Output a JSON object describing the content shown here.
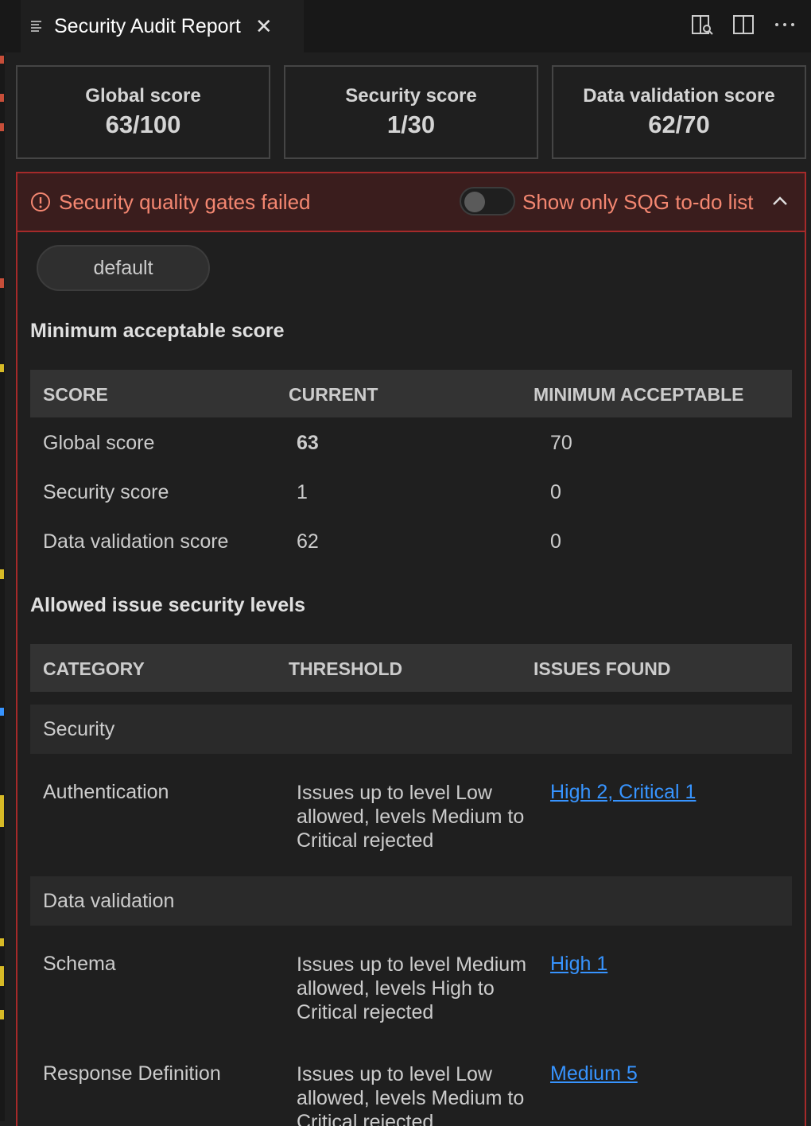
{
  "tab": {
    "title": "Security Audit Report"
  },
  "scores": [
    {
      "label": "Global score",
      "value": "63/100"
    },
    {
      "label": "Security score",
      "value": "1/30"
    },
    {
      "label": "Data validation score",
      "value": "62/70"
    }
  ],
  "gate": {
    "status_text": "Security quality gates failed",
    "toggle_label": "Show only SQG to-do list",
    "toggle_on": false
  },
  "profile_chip": "default",
  "min_score": {
    "title": "Minimum acceptable score",
    "headers": [
      "SCORE",
      "CURRENT",
      "MINIMUM ACCEPTABLE"
    ],
    "rows": [
      {
        "name": "Global score",
        "current": "63",
        "minimum": "70"
      },
      {
        "name": "Security score",
        "current": "1",
        "minimum": "0"
      },
      {
        "name": "Data validation score",
        "current": "62",
        "minimum": "0"
      }
    ]
  },
  "levels": {
    "title": "Allowed issue security levels",
    "headers": [
      "CATEGORY",
      "THRESHOLD",
      "ISSUES FOUND"
    ],
    "groups": [
      {
        "name": "Security",
        "rows": [
          {
            "category": "Authentication",
            "threshold": "Issues up to level Low allowed, levels Medium to Critical rejected",
            "issues": "High 2, Critical 1"
          }
        ]
      },
      {
        "name": "Data validation",
        "rows": [
          {
            "category": "Schema",
            "threshold": "Issues up to level Medium allowed, levels High to Critical rejected",
            "issues": "High 1"
          },
          {
            "category": "Response Definition",
            "threshold": "Issues up to level Low allowed, levels Medium to Critical rejected",
            "issues": "Medium 5"
          }
        ]
      }
    ]
  },
  "colors": {
    "accent_error": "#f48771",
    "border_error": "#a52a2a",
    "link": "#3794ff"
  }
}
